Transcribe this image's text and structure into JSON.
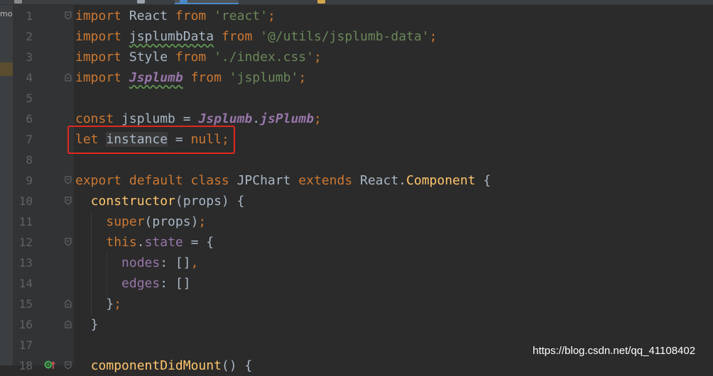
{
  "project_panel": {
    "label": "mo"
  },
  "colors": {
    "background": "#2b2b2b",
    "gutter": "#313335",
    "line_number": "#606366",
    "text": "#a9b7c6",
    "keyword": "#cc7832",
    "string": "#6a8759",
    "global": "#9876aa",
    "property": "#9876aa",
    "function": "#ffc66d",
    "typo_underline": "#629755",
    "annotation_box": "#e0281e"
  },
  "editor": {
    "lines": [
      {
        "number": "1",
        "fold_icon": "fold-start-icon",
        "tokens": [
          {
            "text": "import",
            "style": "keyword"
          },
          {
            "text": " React ",
            "style": "text"
          },
          {
            "text": "from",
            "style": "keyword"
          },
          {
            "text": " ",
            "style": "text"
          },
          {
            "text": "'react'",
            "style": "string"
          },
          {
            "text": ";",
            "style": "punctuation"
          }
        ]
      },
      {
        "number": "2",
        "tokens": [
          {
            "text": "import",
            "style": "keyword"
          },
          {
            "text": " ",
            "style": "text"
          },
          {
            "text": "jsplumbData",
            "style": "text",
            "typo": true
          },
          {
            "text": " ",
            "style": "text"
          },
          {
            "text": "from",
            "style": "keyword"
          },
          {
            "text": " ",
            "style": "text"
          },
          {
            "text": "'@/utils/jsplumb-data'",
            "style": "string"
          },
          {
            "text": ";",
            "style": "punctuation"
          }
        ]
      },
      {
        "number": "3",
        "tokens": [
          {
            "text": "import",
            "style": "keyword"
          },
          {
            "text": " Style ",
            "style": "text"
          },
          {
            "text": "from",
            "style": "keyword"
          },
          {
            "text": " ",
            "style": "text"
          },
          {
            "text": "'./index.css'",
            "style": "string"
          },
          {
            "text": ";",
            "style": "punctuation"
          }
        ]
      },
      {
        "number": "4",
        "fold_icon": "fold-end-icon",
        "tokens": [
          {
            "text": "import",
            "style": "keyword"
          },
          {
            "text": " ",
            "style": "text"
          },
          {
            "text": "Jsplumb",
            "style": "italic-global",
            "typo": true
          },
          {
            "text": " ",
            "style": "text"
          },
          {
            "text": "from",
            "style": "keyword"
          },
          {
            "text": " ",
            "style": "text"
          },
          {
            "text": "'jsplumb'",
            "style": "string"
          },
          {
            "text": ";",
            "style": "punctuation"
          }
        ]
      },
      {
        "number": "5",
        "tokens": []
      },
      {
        "number": "6",
        "tokens": [
          {
            "text": "const",
            "style": "keyword"
          },
          {
            "text": " jsplumb = ",
            "style": "text"
          },
          {
            "text": "Jsplumb",
            "style": "italic-global"
          },
          {
            "text": ".",
            "style": "text"
          },
          {
            "text": "jsPlumb",
            "style": "italic-global"
          },
          {
            "text": ";",
            "style": "punctuation"
          }
        ]
      },
      {
        "number": "7",
        "tokens": [
          {
            "text": "let",
            "style": "keyword"
          },
          {
            "text": " ",
            "style": "text"
          },
          {
            "text": "instance",
            "style": "text",
            "highlight": true
          },
          {
            "text": " = ",
            "style": "text"
          },
          {
            "text": "null",
            "style": "keyword"
          },
          {
            "text": ";",
            "style": "punctuation"
          }
        ]
      },
      {
        "number": "8",
        "tokens": []
      },
      {
        "number": "9",
        "fold_icon": "fold-start-icon",
        "tokens": [
          {
            "text": "export default class",
            "style": "keyword"
          },
          {
            "text": " JPChart ",
            "style": "text"
          },
          {
            "text": "extends",
            "style": "keyword"
          },
          {
            "text": " React.",
            "style": "text"
          },
          {
            "text": "Component",
            "style": "function"
          },
          {
            "text": " {",
            "style": "text"
          }
        ]
      },
      {
        "number": "10",
        "fold_icon": "fold-start-icon",
        "tokens": [
          {
            "text": "  ",
            "style": "text"
          },
          {
            "text": "constructor",
            "style": "function"
          },
          {
            "text": "(props) {",
            "style": "text"
          }
        ]
      },
      {
        "number": "11",
        "tokens": [
          {
            "text": "    ",
            "style": "text"
          },
          {
            "text": "super",
            "style": "keyword"
          },
          {
            "text": "(props)",
            "style": "text"
          },
          {
            "text": ";",
            "style": "punctuation"
          }
        ]
      },
      {
        "number": "12",
        "fold_icon": "fold-start-icon",
        "tokens": [
          {
            "text": "    ",
            "style": "text"
          },
          {
            "text": "this",
            "style": "keyword"
          },
          {
            "text": ".",
            "style": "text"
          },
          {
            "text": "state",
            "style": "property"
          },
          {
            "text": " = {",
            "style": "text"
          }
        ]
      },
      {
        "number": "13",
        "tokens": [
          {
            "text": "      ",
            "style": "text"
          },
          {
            "text": "nodes",
            "style": "property"
          },
          {
            "text": ": []",
            "style": "text"
          },
          {
            "text": ",",
            "style": "punctuation"
          }
        ]
      },
      {
        "number": "14",
        "tokens": [
          {
            "text": "      ",
            "style": "text"
          },
          {
            "text": "edges",
            "style": "property"
          },
          {
            "text": ": []",
            "style": "text"
          }
        ]
      },
      {
        "number": "15",
        "fold_icon": "fold-end-icon",
        "tokens": [
          {
            "text": "    }",
            "style": "text"
          },
          {
            "text": ";",
            "style": "punctuation"
          }
        ]
      },
      {
        "number": "16",
        "fold_icon": "fold-end-icon",
        "tokens": [
          {
            "text": "  }",
            "style": "text"
          }
        ]
      },
      {
        "number": "17",
        "tokens": []
      },
      {
        "number": "18",
        "fold_icon": "fold-start-icon",
        "gutter_icon": "override-method-icon",
        "tokens": [
          {
            "text": "  ",
            "style": "text"
          },
          {
            "text": "componentDidMount",
            "style": "function"
          },
          {
            "text": "() {",
            "style": "text"
          }
        ]
      }
    ]
  },
  "watermark": "https://blog.csdn.net/qq_41108402"
}
